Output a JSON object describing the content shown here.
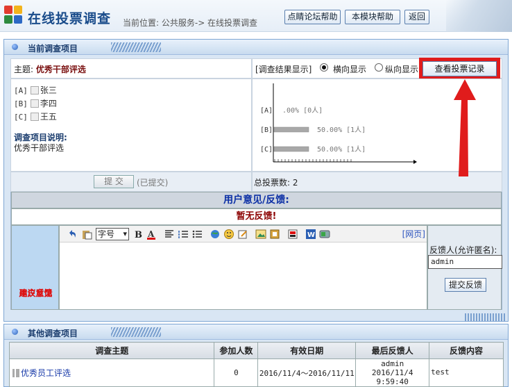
{
  "header": {
    "title": "在线投票调查",
    "breadcrumb": "当前位置: 公共服务-> 在线投票调查",
    "buttons": [
      "点睛论坛帮助",
      "本模块帮助",
      "返回"
    ]
  },
  "current": {
    "panel_title": "当前调查项目",
    "topic_label": "主题: ",
    "topic": "优秀干部评选",
    "options": [
      {
        "tag": "[A]",
        "name": "张三"
      },
      {
        "tag": "[B]",
        "name": "李四"
      },
      {
        "tag": "[C]",
        "name": "王五"
      }
    ],
    "desc_title": "调查项目说明:",
    "desc_body": "优秀干部评选",
    "display_label": "[调查结果显示]",
    "radio_horizontal": "横向显示",
    "radio_vertical": "纵向显示",
    "view_button": "查看投票记录",
    "submit_button": "提 交",
    "submitted_note": "(已提交)",
    "total_votes": "总投票数: 2"
  },
  "chart_data": {
    "type": "bar",
    "categories": [
      "[A]",
      "[B]",
      "[C]"
    ],
    "values": [
      0,
      1,
      1
    ],
    "labels": [
      ".00% [0人]",
      "50.00% [1人]",
      "50.00% [1人]"
    ],
    "orientation": "horizontal",
    "xlim": [
      0,
      2
    ]
  },
  "feedback": {
    "title": "用户意见/反馈:",
    "none": "暂无反馈!",
    "side_label_1": "用户意见",
    "side_label_2": "建议反馈",
    "font_select": "字号",
    "web_tab": "[网页]",
    "user_label": "反馈人(允许匿名):",
    "user_value": "admin",
    "submit": "提交反馈"
  },
  "other": {
    "panel_title": "其他调查项目",
    "columns": [
      "调查主题",
      "参加人数",
      "有效日期",
      "最后反馈人",
      "反馈内容"
    ],
    "rows": [
      {
        "topic": "优秀员工评选",
        "count": "0",
        "dates": "2016/11/4～2016/11/11",
        "last_user": "admin",
        "last_time": "2016/11/4 9:59:40",
        "content": "test"
      }
    ]
  },
  "colors": {
    "accent": "#1a4c8b",
    "highlight": "#e01c1c",
    "topic": "#7a1010"
  }
}
